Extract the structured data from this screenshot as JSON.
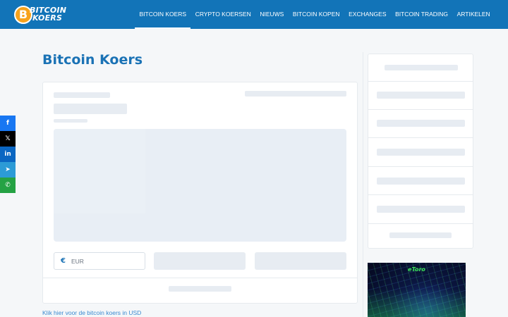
{
  "header": {
    "logo": {
      "line1": "BITCOIN",
      "line2": "KOERS",
      "coin_symbol": "B"
    },
    "nav": [
      {
        "label": "BITCOIN KOERS",
        "active": true
      },
      {
        "label": "CRYPTO KOERSEN",
        "active": false
      },
      {
        "label": "NIEUWS",
        "active": false
      },
      {
        "label": "BITCOIN KOPEN",
        "active": false
      },
      {
        "label": "EXCHANGES",
        "active": false
      },
      {
        "label": "BITCOIN TRADING",
        "active": false
      },
      {
        "label": "ARTIKELEN",
        "active": false
      }
    ]
  },
  "share": {
    "facebook": "f",
    "x": "𝕏",
    "linkedin": "in",
    "telegram": "➤",
    "whatsapp": "✆"
  },
  "main": {
    "title": "Bitcoin Koers",
    "currency": {
      "symbol": "€",
      "value": "EUR"
    },
    "usd_link": "Klik hier voor de bitcoin koers in USD"
  },
  "ad": {
    "brand": "eToro"
  },
  "colors": {
    "header_bg": "#1274b8",
    "title": "#1a72b5",
    "link": "#3a8ad0",
    "skeleton": "#e7ecf2"
  }
}
